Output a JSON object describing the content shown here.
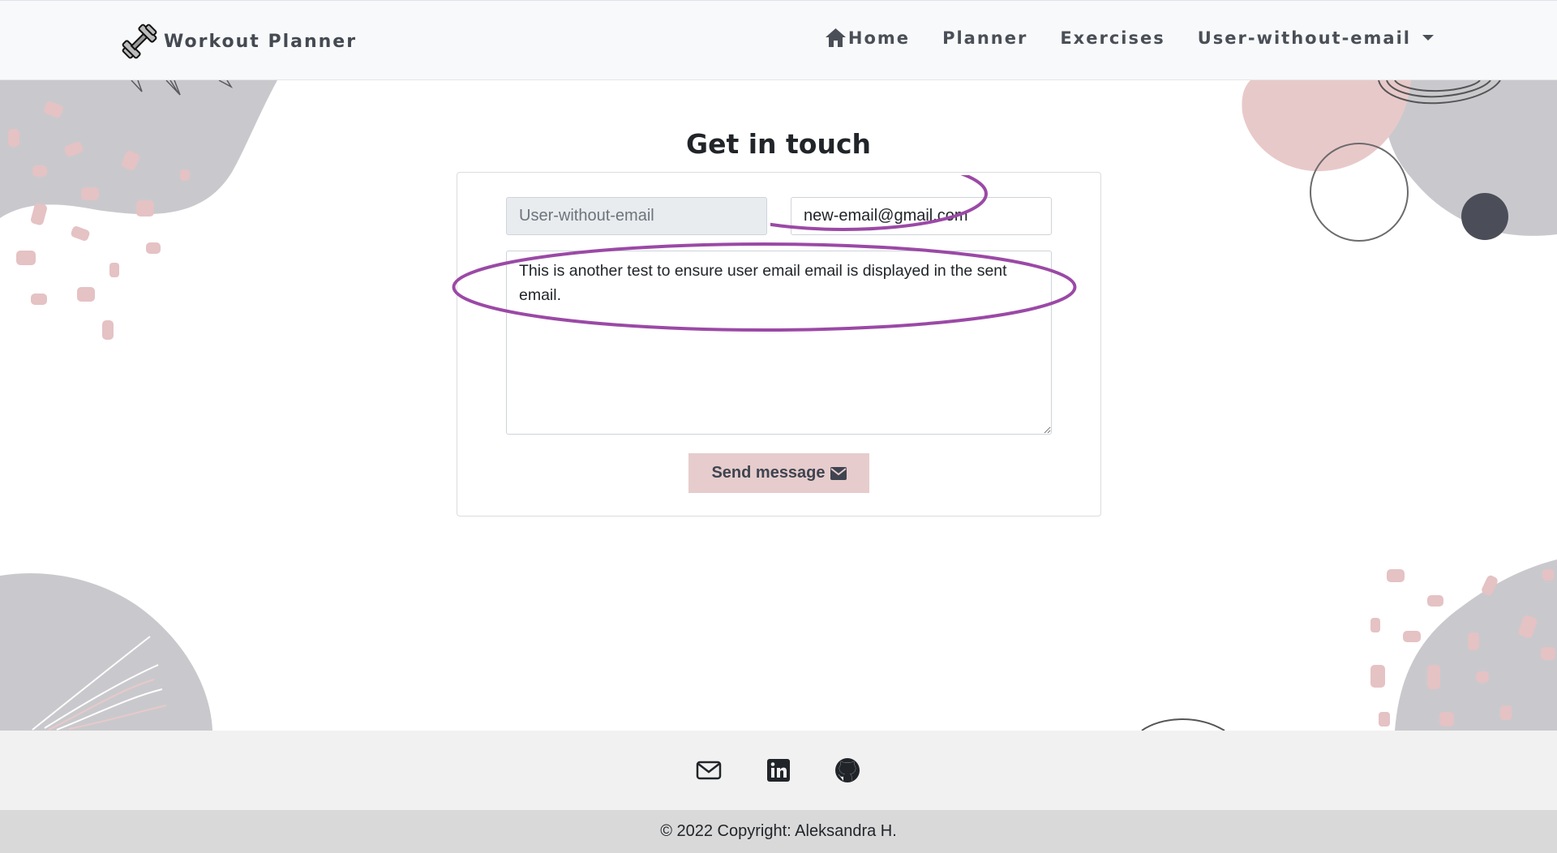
{
  "navbar": {
    "brand": "Workout Planner",
    "links": {
      "home": "Home",
      "planner": "Planner",
      "exercises": "Exercises",
      "user": "User-without-email"
    }
  },
  "main": {
    "title": "Get in touch",
    "username_value": "User-without-email",
    "email_value": "new-email@gmail.com",
    "message_value": "This is another test to ensure user email email is displayed in the sent email.",
    "send_label": "Send message"
  },
  "footer": {
    "icons": [
      "envelope-icon",
      "linkedin-icon",
      "github-icon"
    ],
    "copyright": "© 2022 Copyright: Aleksandra H."
  },
  "colors": {
    "accent_button": "#e6cccc",
    "annotation": "#9b49a6",
    "blob_gray": "#c9c9cd",
    "blob_pink": "#e8c9c9"
  }
}
